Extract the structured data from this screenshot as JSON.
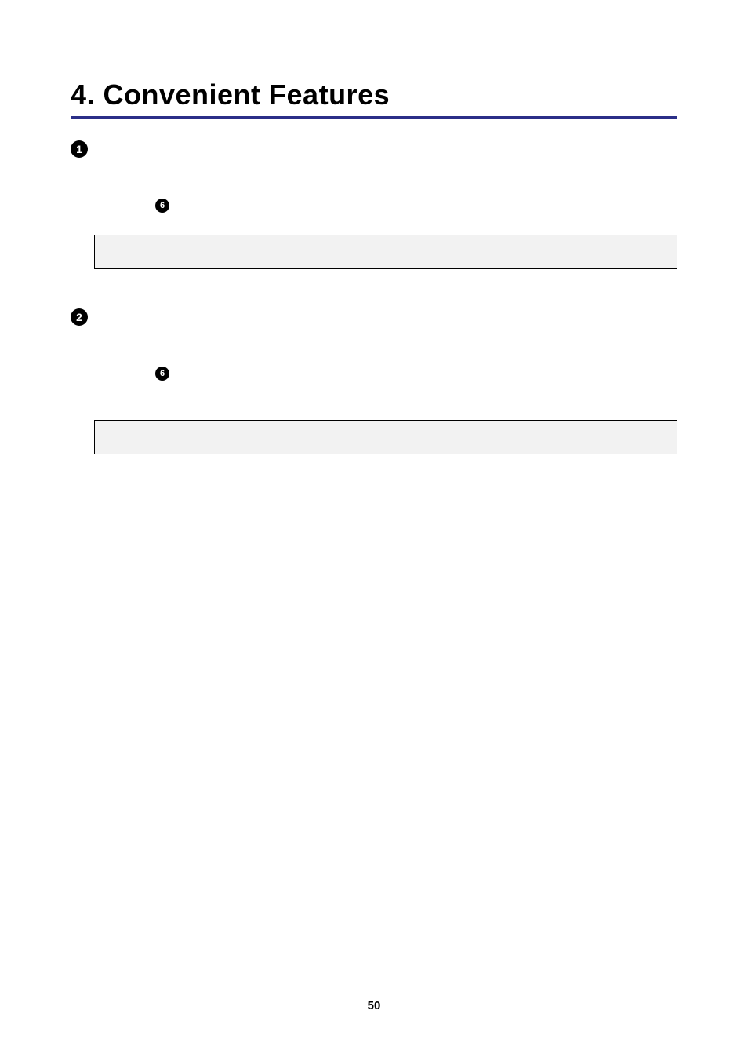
{
  "chapter": {
    "title": "4. Convenient Features"
  },
  "sections": [
    {
      "number": "1",
      "ref_number": "6"
    },
    {
      "number": "2",
      "ref_number": "6"
    }
  ],
  "page_number": "50"
}
